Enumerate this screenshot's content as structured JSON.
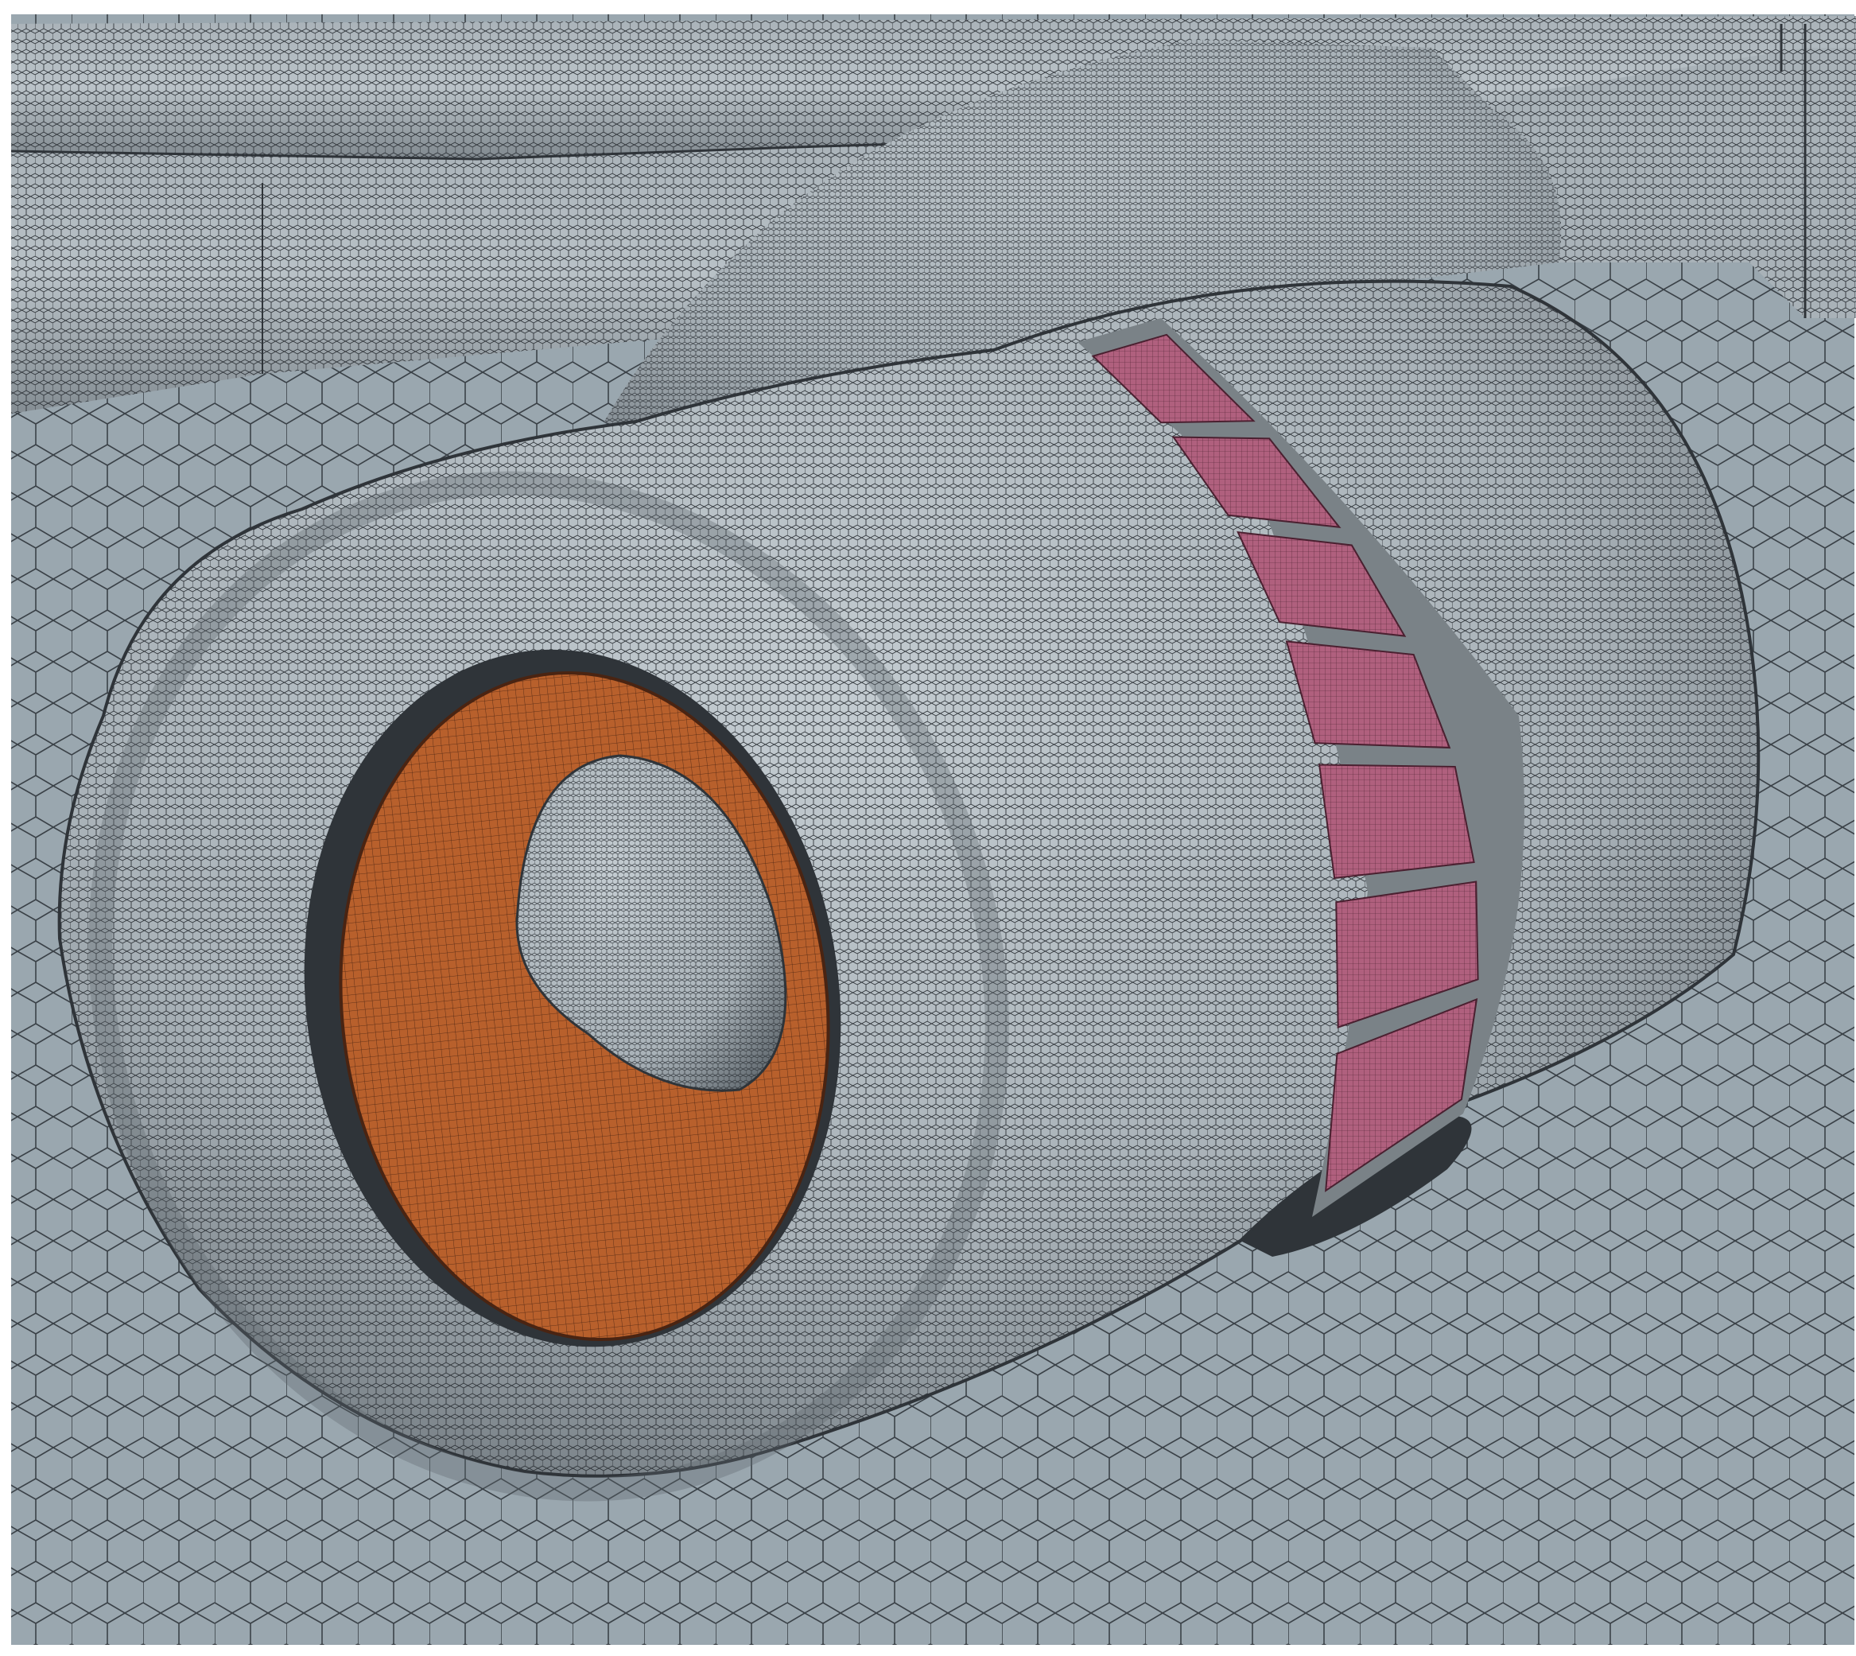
{
  "scene": {
    "subject": "engine-nacelle-mesh",
    "colors": {
      "frame": "#ffffff",
      "ground_fill": "#9aa7af",
      "ground_edges": "#3a4147",
      "surface_fill": "#a9b2b8",
      "surface_highlight": "#c8d0d5",
      "surface_shadow": "#5f676d",
      "surface_edges": "#2f3439",
      "fan_face_fill": "#b8602c",
      "fan_face_edges": "#4a2412",
      "exhaust_panel_fill": "#b0607e",
      "exhaust_panel_edges": "#4a2030",
      "panel_gap": "#7a8287"
    },
    "panels": {
      "count": 7
    }
  }
}
